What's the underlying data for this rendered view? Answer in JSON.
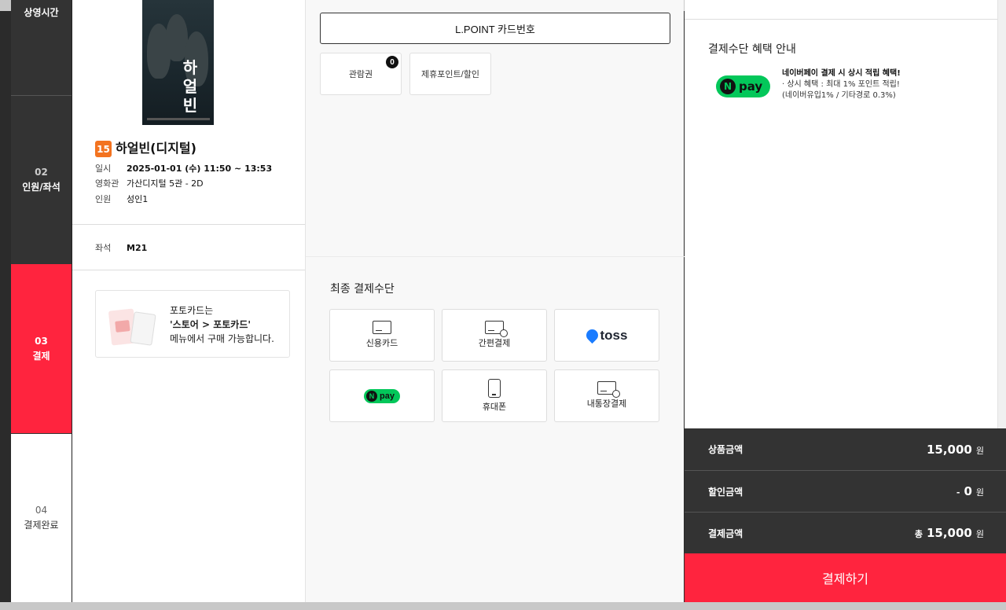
{
  "steps": [
    {
      "num": "",
      "label": "상영시간"
    },
    {
      "num": "02",
      "label": "인원/좌석"
    },
    {
      "num": "03",
      "label": "결제"
    },
    {
      "num": "04",
      "label": "결제완료"
    }
  ],
  "movie": {
    "poster_title": "하얼빈",
    "rating": "15",
    "title": "하얼빈(디지털)",
    "info": [
      {
        "key": "일시",
        "value": "2025-01-01 (수) 11:50 ~ 13:53"
      },
      {
        "key": "영화관",
        "value": "가산디지털 5관 - 2D"
      },
      {
        "key": "인원",
        "value": "성인1"
      }
    ],
    "seat": {
      "key": "좌석",
      "value": "M21"
    }
  },
  "promo": {
    "line1": "포토카드는",
    "line2": "'스토어 > 포토카드'",
    "line3": "메뉴에서 구매 가능합니다."
  },
  "payment": {
    "lpoint_label": "L.POINT 카드번호",
    "ticket_label": "관람권",
    "ticket_count": "0",
    "partner_label": "제휴포인트/할인",
    "final_title": "최종 결제수단",
    "methods": {
      "credit_card": "신용카드",
      "easy_pay": "간편결제",
      "toss": "toss",
      "npay": "pay",
      "npay_n": "N",
      "mobile": "휴대폰",
      "bank": "내통장결제"
    }
  },
  "benefit": {
    "title": "결제수단 혜택 안내",
    "logo_n": "N",
    "logo_text": "pay",
    "headline": "네이버페이 결제 시 상시 적립 혜택!",
    "line1": "· 상시 혜택 : 최대 1% 포인트 적립!",
    "line2": "(네이버유입1% / 기타경로 0.3%)"
  },
  "summary": {
    "product_label": "상품금액",
    "product_value": "15,000",
    "discount_label": "할인금액",
    "discount_prefix": "-",
    "discount_value": "0",
    "total_label": "결제금액",
    "total_prefix": "총",
    "total_value": "15,000",
    "unit": "원",
    "pay_button": "결제하기"
  },
  "colors": {
    "accent": "#ff243e",
    "sidebar": "#333333",
    "rating": "#f37320",
    "npay": "#03c75a",
    "toss": "#1a7cff"
  }
}
